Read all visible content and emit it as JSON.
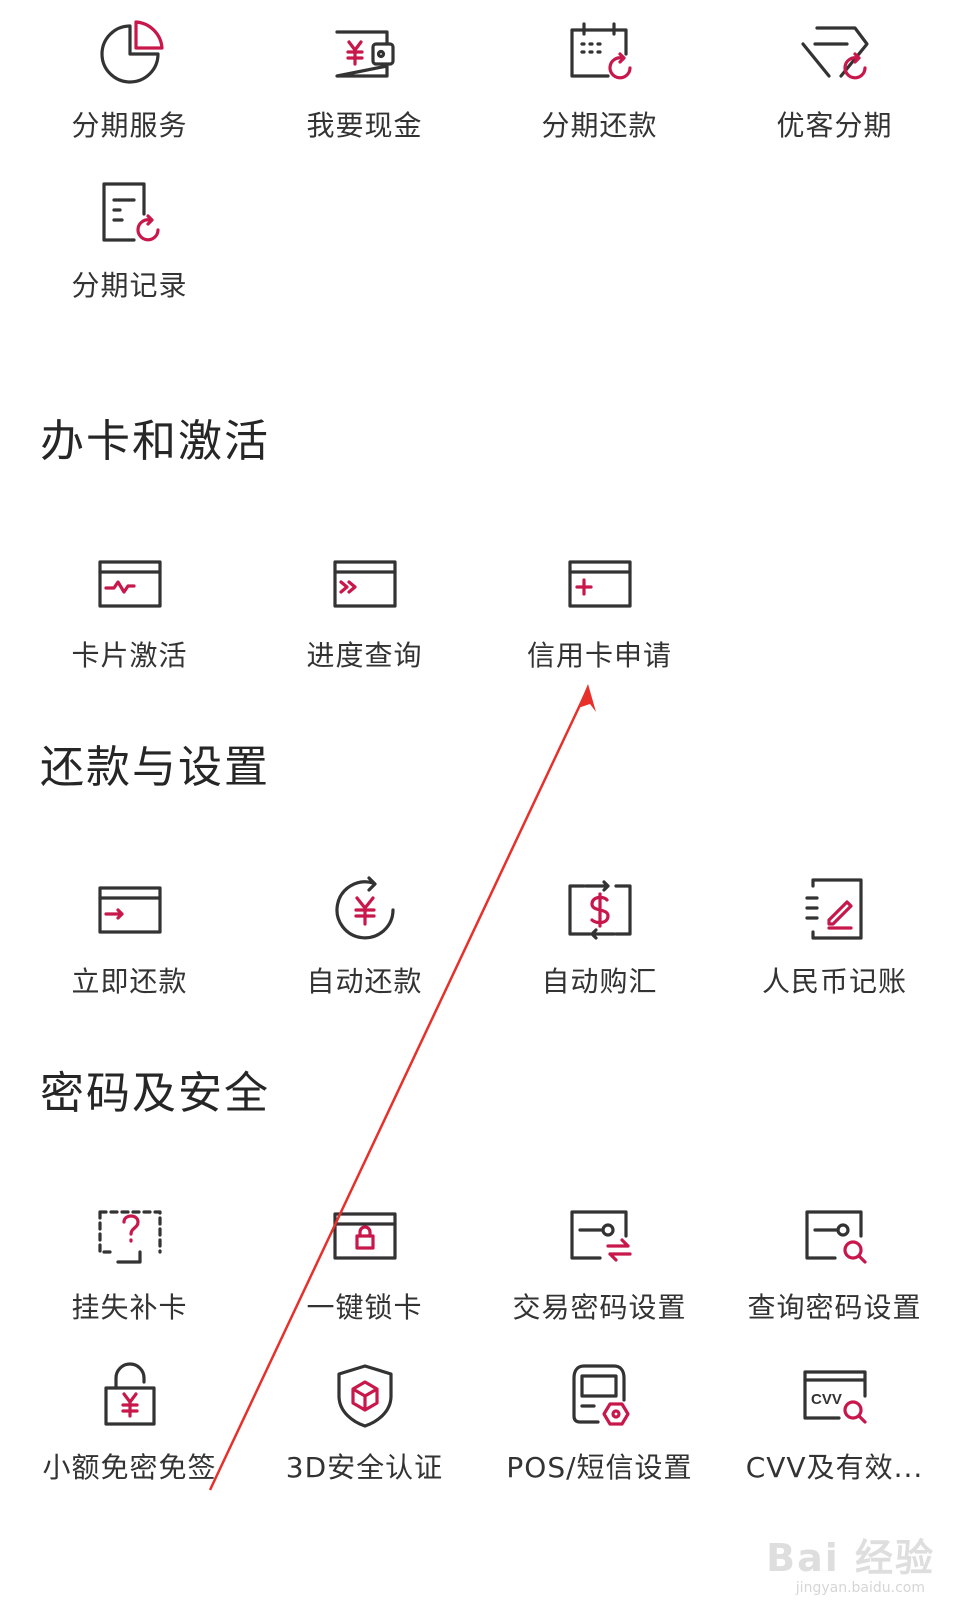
{
  "colors": {
    "accent": "#c8174b",
    "icon_dark": "#333333",
    "annotation_arrow": "#e8302a"
  },
  "installment": {
    "items": [
      {
        "label": "分期服务",
        "icon": "pie-chart-icon"
      },
      {
        "label": "我要现金",
        "icon": "cash-wallet-icon"
      },
      {
        "label": "分期还款",
        "icon": "calendar-repay-icon"
      },
      {
        "label": "优客分期",
        "icon": "diamond-installment-icon"
      },
      {
        "label": "分期记录",
        "icon": "record-document-icon"
      }
    ]
  },
  "apply_activate": {
    "title": "办卡和激活",
    "items": [
      {
        "label": "卡片激活",
        "icon": "card-activate-icon"
      },
      {
        "label": "进度查询",
        "icon": "card-progress-icon"
      },
      {
        "label": "信用卡申请",
        "icon": "card-apply-icon"
      }
    ]
  },
  "repay_settings": {
    "title": "还款与设置",
    "items": [
      {
        "label": "立即还款",
        "icon": "card-repay-icon"
      },
      {
        "label": "自动还款",
        "icon": "auto-repay-icon"
      },
      {
        "label": "自动购汇",
        "icon": "auto-exchange-icon"
      },
      {
        "label": "人民币记账",
        "icon": "rmb-ledger-icon"
      }
    ]
  },
  "security": {
    "title": "密码及安全",
    "items": [
      {
        "label": "挂失补卡",
        "icon": "lost-card-icon"
      },
      {
        "label": "一键锁卡",
        "icon": "lock-card-icon"
      },
      {
        "label": "交易密码设置",
        "icon": "transaction-password-icon"
      },
      {
        "label": "查询密码设置",
        "icon": "query-password-icon"
      },
      {
        "label": "小额免密免签",
        "icon": "small-amount-lock-icon"
      },
      {
        "label": "3D安全认证",
        "icon": "shield-3d-icon"
      },
      {
        "label": "POS/短信设置",
        "icon": "pos-sms-icon"
      },
      {
        "label": "CVV及有效...",
        "icon": "cvv-validity-icon"
      }
    ]
  },
  "watermark": {
    "text": "Bai 经验",
    "sub": "jingyan.baidu.com"
  }
}
